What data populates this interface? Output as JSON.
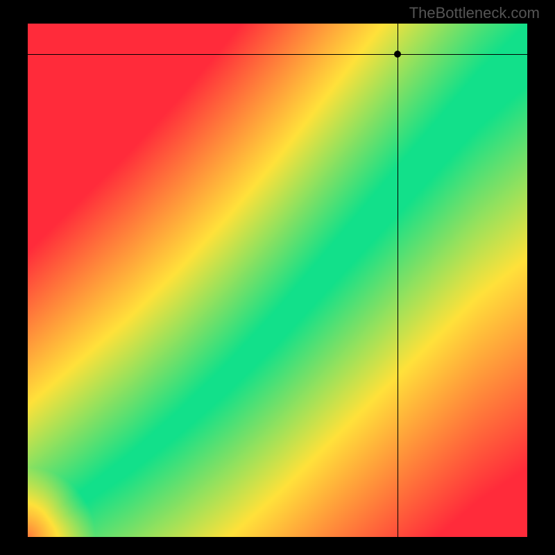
{
  "watermark": "TheBottleneck.com",
  "chart_data": {
    "type": "heatmap",
    "title": "",
    "xlabel": "",
    "ylabel": "",
    "xlim": [
      0,
      100
    ],
    "ylim": [
      0,
      100
    ],
    "crosshair": {
      "x": 74,
      "y": 94
    },
    "ridge": [
      {
        "x": 0,
        "y": 0
      },
      {
        "x": 10,
        "y": 7
      },
      {
        "x": 20,
        "y": 14
      },
      {
        "x": 30,
        "y": 22
      },
      {
        "x": 40,
        "y": 31
      },
      {
        "x": 50,
        "y": 41
      },
      {
        "x": 60,
        "y": 52
      },
      {
        "x": 70,
        "y": 63
      },
      {
        "x": 80,
        "y": 74
      },
      {
        "x": 90,
        "y": 85
      },
      {
        "x": 100,
        "y": 94
      }
    ],
    "band_width": 12,
    "colors": {
      "low": "#ff2b3a",
      "mid": "#ffe23a",
      "high": "#12e08a"
    }
  }
}
